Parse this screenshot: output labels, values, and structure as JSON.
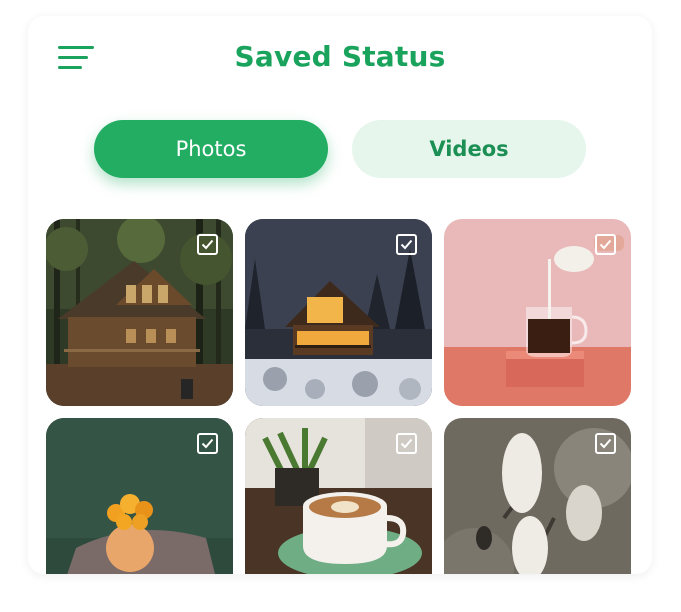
{
  "header": {
    "title": "Saved Status",
    "menu_icon": "hamburger-menu-icon"
  },
  "tabs": [
    {
      "label": "Photos",
      "selected": true
    },
    {
      "label": "Videos",
      "selected": false
    }
  ],
  "colors": {
    "accent": "#22ad63",
    "title": "#1aa35d",
    "tab_inactive_bg": "#e6f6ec"
  },
  "gallery": {
    "items": [
      {
        "subject": "forest cabin",
        "selected": true
      },
      {
        "subject": "cabin at night in snow",
        "selected": true
      },
      {
        "subject": "milk poured into coffee cup",
        "selected": true
      },
      {
        "subject": "orange flowers in vase",
        "selected": true
      },
      {
        "subject": "latte art coffee",
        "selected": true
      },
      {
        "subject": "magnolia buds",
        "selected": true
      }
    ]
  }
}
